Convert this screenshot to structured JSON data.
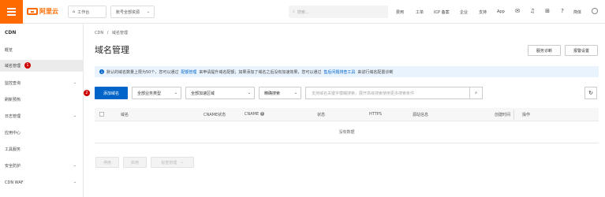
{
  "topbar": {
    "logo_text": "阿里云",
    "workspace_label": "工作台",
    "region_label": "账号全部资源",
    "search_placeholder": "搜索...",
    "nav": [
      "费用",
      "工单",
      "ICP 备案",
      "企业",
      "支持",
      "App"
    ],
    "user_label": "简体"
  },
  "sidebar": {
    "title": "CDN",
    "items": [
      {
        "label": "概览"
      },
      {
        "label": "域名管理"
      },
      {
        "label": "监控查询"
      },
      {
        "label": "刷新预热"
      },
      {
        "label": "日志管理"
      },
      {
        "label": "应用中心"
      },
      {
        "label": "工具服务"
      },
      {
        "label": "安全防护"
      },
      {
        "label": "CDN WAF"
      }
    ],
    "badge": "1"
  },
  "breadcrumb": {
    "root": "CDN",
    "sep": "/",
    "current": "域名管理"
  },
  "page_title": "域名管理",
  "header_buttons": {
    "diagnose": "服务诊断",
    "alarm": "报警设置"
  },
  "notice": {
    "text1": "默认的域名数量上限为50个，您可以通过",
    "link1": "配额管理",
    "text2": "来申请提升域名配额；如果添加了域名之后没有加速效果，您可以通过",
    "link2": "售后问题排查工具",
    "text3": "来进行域名配置诊断"
  },
  "toolbar": {
    "add_button": "添加域名",
    "business_type": "全部业务类型",
    "accel_region": "全部加速区域",
    "precise_search": "精确搜索",
    "search_placeholder": "支持域名关键字模糊搜索，展开高级搜索使用更多搜索条件",
    "badge": "2"
  },
  "table": {
    "columns": [
      "域名",
      "CNAME状态",
      "CNAME",
      "状态",
      "HTTPS",
      "源站信息",
      "创建时间",
      "操作"
    ],
    "empty_text": "没有数据"
  },
  "bottom_buttons": {
    "disable": "停用",
    "enable": "启用",
    "tag_manage": "标签管理"
  }
}
